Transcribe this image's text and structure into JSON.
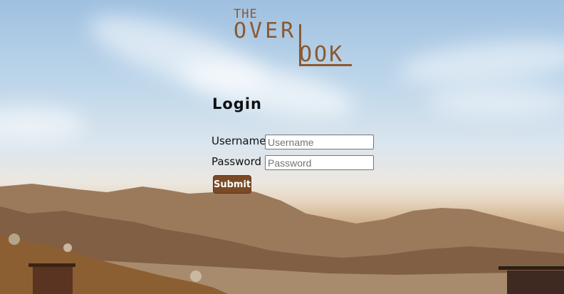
{
  "logo": {
    "line1": "THE",
    "line2": "OVER",
    "line3": "OOK",
    "color": "#8a5a31"
  },
  "login": {
    "title": "Login",
    "username_label": "Username",
    "username_placeholder": "Username",
    "username_value": "",
    "password_label": "Password",
    "password_placeholder": "Password",
    "password_value": "",
    "submit_label": "Submit"
  },
  "colors": {
    "button_bg": "#7b4a26",
    "button_text": "#ffffff"
  }
}
